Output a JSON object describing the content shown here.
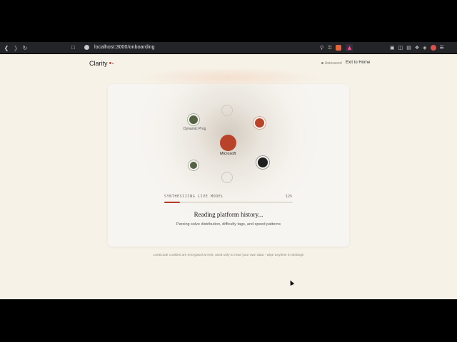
{
  "browser": {
    "url": "localhost:3000/onboarding",
    "back_icon": "chevron-left-icon",
    "forward_icon": "chevron-right-icon",
    "reload_icon": "reload-icon"
  },
  "header": {
    "brand": "Clarity",
    "autosaved": "Autosaved",
    "exit_label": "Exit to Home"
  },
  "graph": {
    "center_label": "Microsoft",
    "node_label": "Dynamic Prog"
  },
  "progress": {
    "label": "SYNTHESIZING LIVE MODEL",
    "percent_text": "12%",
    "value": 0.12
  },
  "status": {
    "heading": "Reading platform history...",
    "subtext": "Parsing solve distribution, difficulty tags, and speed patterns"
  },
  "footnote": "LeetCode cookies are encrypted at rest, used only to read your own data - wipe anytime in Settings",
  "colors": {
    "accent": "#c0492f",
    "background": "#f6f2e8",
    "green_node": "#556345",
    "dark_node": "#1f1f1f"
  }
}
